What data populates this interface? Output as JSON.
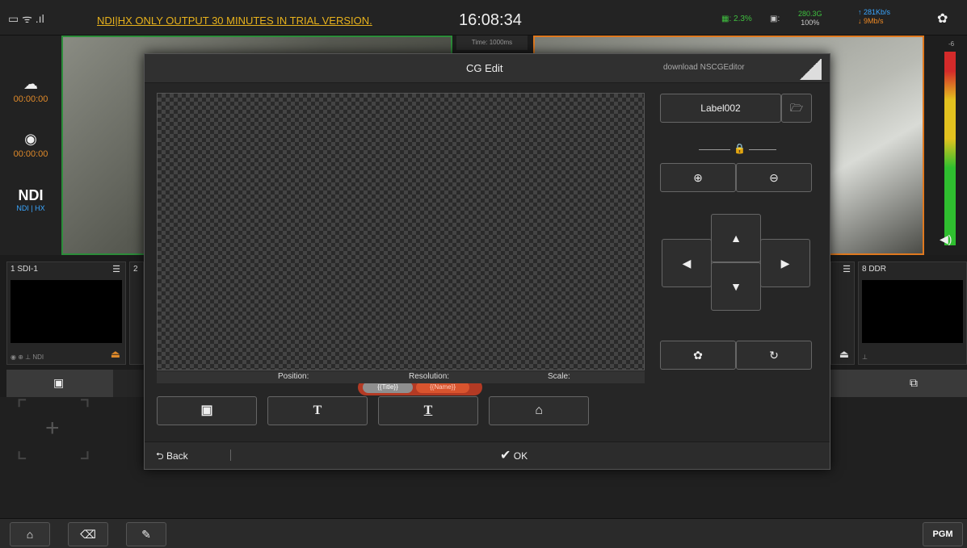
{
  "topbar": {
    "signal_icons": "▭ ᯤ .ıl",
    "trial_notice": "NDI|HX ONLY OUTPUT 30 MINUTES IN TRIAL VERSION.",
    "clock": "16:08:34",
    "cpu_label": "2.3%",
    "disk_icon": "▣:",
    "disk_free": "280.3G",
    "disk_pct": "100%",
    "net_up": "↑ 281Kb/s",
    "net_down": "↓ 9Mb/s"
  },
  "preview": {
    "time_tag": "Time: 1000ms",
    "meter_top": "-6"
  },
  "left_rail": {
    "stream_time": "00:00:00",
    "record_time": "00:00:00",
    "ndi_logo": "NDI",
    "ndi_sub": "NDI | HX"
  },
  "sources": [
    {
      "label": "1 SDI-1",
      "footer": "◉ ⊕ ⊥ NDI"
    },
    {
      "label": "2"
    },
    {
      "label": "8 DDR",
      "footer": "⊥"
    }
  ],
  "dialog": {
    "title": "CG Edit",
    "download_link": "download NSCGEditor",
    "lower_third": {
      "title": "{{Title}}",
      "name": "{{Name}}"
    },
    "info": {
      "position": "Position:",
      "resolution": "Resolution:",
      "scale": "Scale:"
    },
    "label_name": "Label002",
    "back_label": "Back",
    "ok_label": "OK"
  },
  "bottombar": {
    "pgm_label": "PGM"
  },
  "colors": {
    "accent_orange": "#e08a2a",
    "accent_green": "#2c8d3a",
    "trial_yellow": "#e8b21c",
    "lower_third_red": "#b33a24"
  }
}
